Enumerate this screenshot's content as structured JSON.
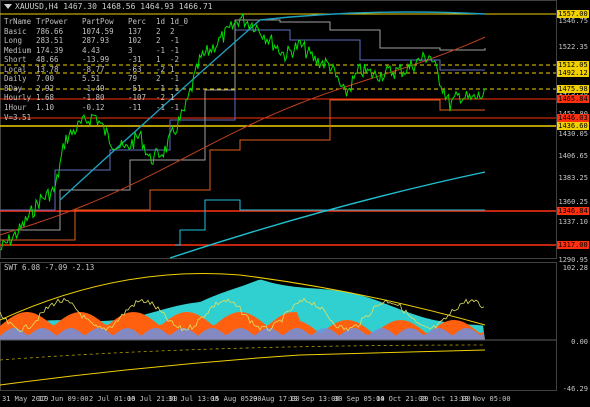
{
  "header": {
    "symbol_label": "XAUUSD,H4",
    "ohlc": "1467.30 1468.56 1464.93 1466.71"
  },
  "table": {
    "columns": [
      "TrName",
      "TrPower",
      "PartPow",
      "Perc",
      "1d",
      "1d_0"
    ],
    "rows": [
      [
        "Basic",
        "786.66",
        "1074.59",
        "137",
        "2",
        "2"
      ],
      [
        "Long",
        "283.51",
        "287.93",
        "102",
        "2",
        "-1"
      ],
      [
        "Medium",
        "174.39",
        "4.43",
        "3",
        "-1",
        "-1"
      ],
      [
        "Short",
        "48.66",
        "-13.99",
        "-31",
        "1",
        "-2"
      ],
      [
        "Local",
        "13.78",
        "-8.77",
        "-63",
        "-2",
        "1"
      ],
      [
        "Daily",
        "7.00",
        "5.51",
        "79",
        "2",
        "-1"
      ],
      [
        "8Day",
        "2.92",
        "-1.49",
        "-51",
        "-1",
        "-1"
      ],
      [
        "Hourly",
        "1.68",
        "-1.80",
        "-107",
        "-2",
        "1"
      ],
      [
        "1Hour",
        "1.10",
        "-0.12",
        "-11",
        "-1",
        "-1"
      ]
    ]
  },
  "v_label": "V=3.51",
  "price_axis": [
    "1546.75",
    "1522.35",
    "1498.85",
    "1475.98",
    "1452.80",
    "1430.05",
    "1406.65",
    "1383.25",
    "1360.25",
    "1337.10",
    "1313.70",
    "1290.95"
  ],
  "price_tags": [
    {
      "text": "1557.00",
      "color": "#f0d000"
    },
    {
      "text": "1512.05",
      "color": "#f0d000"
    },
    {
      "text": "1492.12",
      "color": "#f0d000"
    },
    {
      "text": "1475.98",
      "color": "#f0d000"
    },
    {
      "text": "1465.84",
      "color": "#ff3010"
    },
    {
      "text": "1446.03",
      "color": "#ff3010"
    },
    {
      "text": "1436.60",
      "color": "#f0d000"
    },
    {
      "text": "1346.84",
      "color": "#ff3010"
    },
    {
      "text": "1317.00",
      "color": "#ff3010"
    }
  ],
  "subwindow": {
    "label": "SWT 6.08 -7.09 -2.13",
    "axis": [
      "102.28",
      "0.00",
      "-46.29"
    ]
  },
  "time_axis": [
    "31 May 2019",
    "17 Jun 09:00",
    "2 Jul 01:00",
    "16 Jul 21:00",
    "31 Jul 13:00",
    "15 Aug 05:00",
    "29 Aug 17:00",
    "13 Sep 13:00",
    "30 Sep 05:00",
    "14 Oct 21:00",
    "29 Oct 13:00",
    "13 Nov 05:00"
  ],
  "colors": {
    "price": "#00e000",
    "yellow": "#f0d000",
    "red": "#ff3010",
    "cyan": "#20c0e0",
    "orange": "#ff6010",
    "aqua": "#30d0d0"
  }
}
